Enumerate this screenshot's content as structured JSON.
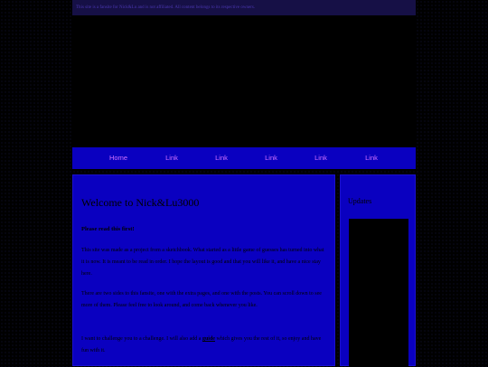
{
  "top_notice": "This site is a fansite for Nick&Lu and is not affiliated. All content belongs to its respective owners.",
  "nav": {
    "items": [
      "Home",
      "Link",
      "Link",
      "Link",
      "Link",
      "Link"
    ]
  },
  "main": {
    "title": "Welcome to Nick&Lu3000",
    "subtitle": "Please read this first!",
    "paragraphs": [
      "This site was made as a project from a sketchbook. What started as a little game of guesses has turned into what it is now. It is meant to be read in order. I hope the layout is good and that you will like it, and have a nice stay here.",
      "There are two sides to this fansite, one with the extra pages, and one with the posts. You can scroll down to see more of them. Please feel free to look around, and come back whenever you like.",
      "I want to challenge you to a challenge. I will also add a"
    ],
    "inline_link": "guide",
    "p3_tail": "which gives you the rest of it, so enjoy and have fun with it."
  },
  "sidebar": {
    "title": "Updates"
  },
  "colors": {
    "panel": "#0a00c0",
    "nav_link": "#d070ff",
    "background": "#000000"
  }
}
